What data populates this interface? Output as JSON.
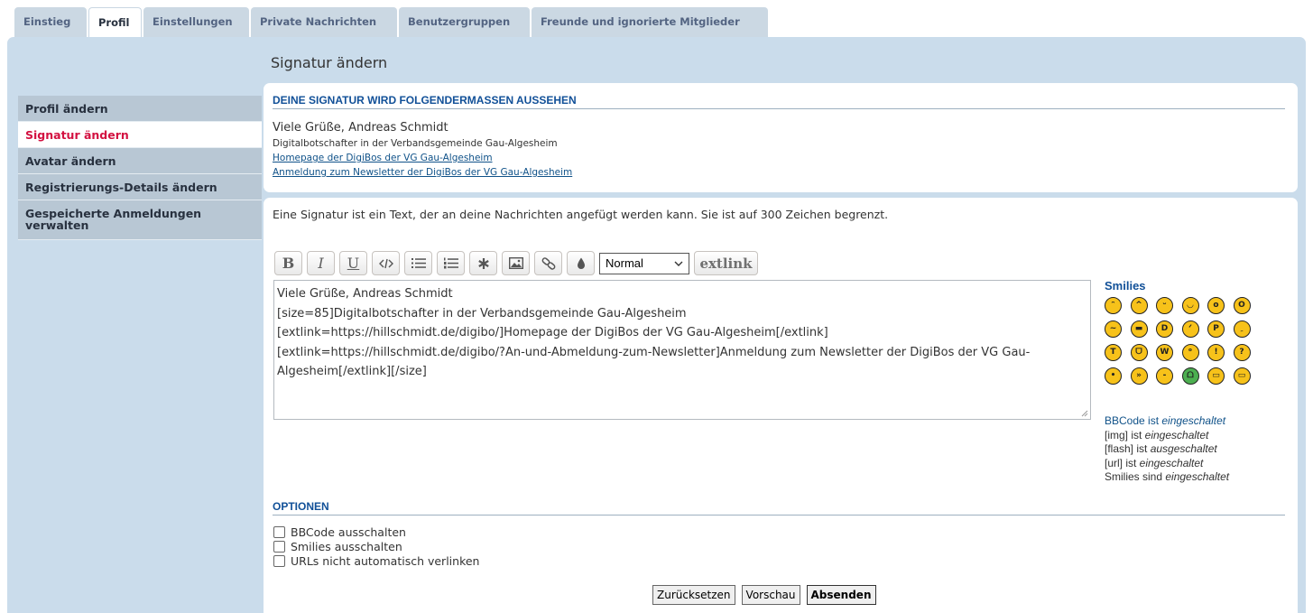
{
  "tabs": [
    {
      "label": "Einstieg"
    },
    {
      "label": "Profil"
    },
    {
      "label": "Einstellungen"
    },
    {
      "label": "Private Nachrichten"
    },
    {
      "label": "Benutzergruppen"
    },
    {
      "label": "Freunde und ignorierte Mitglieder"
    }
  ],
  "page_title": "Signatur ändern",
  "sidebar": {
    "items": [
      {
        "label": "Profil ändern"
      },
      {
        "label": "Signatur ändern"
      },
      {
        "label": "Avatar ändern"
      },
      {
        "label": "Registrierungs-Details ändern"
      },
      {
        "label": "Gespeicherte Anmeldungen verwalten"
      }
    ]
  },
  "preview": {
    "heading": "DEINE SIGNATUR WIRD FOLGENDERMASSEN AUSSEHEN",
    "name": "Viele Grüße, Andreas Schmidt",
    "subtitle": "Digitalbotschafter in der Verbandsgemeinde Gau-Algesheim",
    "link1": "Homepage der DigiBos der VG Gau-Algesheim",
    "link2": "Anmeldung zum Newsletter der DigiBos der VG Gau-Algesheim"
  },
  "editor": {
    "description": "Eine Signatur ist ein Text, der an deine Nachrichten angefügt werden kann. Sie ist auf 300 Zeichen begrenzt.",
    "toolbar": {
      "bold": "B",
      "italic": "I",
      "underline": "U",
      "font_size_selected": "Normal",
      "extlink": "extlink"
    },
    "message": "Viele Grüße, Andreas Schmidt\n[size=85]Digitalbotschafter in der Verbandsgemeinde Gau-Algesheim\n[extlink=https://hillschmidt.de/digibo/]Homepage der DigiBos der VG Gau-Algesheim[/extlink]\n[extlink=https://hillschmidt.de/digibo/?An-und-Abmeldung-zum-Newsletter]Anmeldung zum Newsletter der DigiBos der VG Gau-Algesheim[/extlink][/size]"
  },
  "smilies": {
    "title": "Smilies",
    "icons": [
      "laugh-icon",
      "smile-icon",
      "wink-icon",
      "grin-icon",
      "surprised-icon",
      "eek-icon",
      "confused-icon",
      "cool-icon",
      "lol-icon",
      "mad-icon",
      "razz-icon",
      "redface-icon",
      "cry-icon",
      "evil-icon",
      "twisted-icon",
      "rolleyes-icon",
      "exclaim-icon",
      "question-icon",
      "idea-icon",
      "arrow-icon",
      "neutral-icon",
      "mrgreen-icon",
      "geek-icon",
      "ugeek-icon"
    ]
  },
  "bbinfo": {
    "bbcode_prefix": "BBCode ist ",
    "bbcode_state": "eingeschaltet",
    "img_prefix": "[img] ist ",
    "img_state": "eingeschaltet",
    "flash_prefix": "[flash] ist ",
    "flash_state": "ausgeschaltet",
    "url_prefix": "[url] ist ",
    "url_state": "eingeschaltet",
    "smilies_prefix": "Smilies sind ",
    "smilies_state": "eingeschaltet"
  },
  "options": {
    "heading": "OPTIONEN",
    "items": [
      {
        "label": "BBCode ausschalten"
      },
      {
        "label": "Smilies ausschalten"
      },
      {
        "label": "URLs nicht automatisch verlinken"
      }
    ]
  },
  "buttons": {
    "reset": "Zurücksetzen",
    "preview": "Vorschau",
    "submit": "Absenden"
  }
}
